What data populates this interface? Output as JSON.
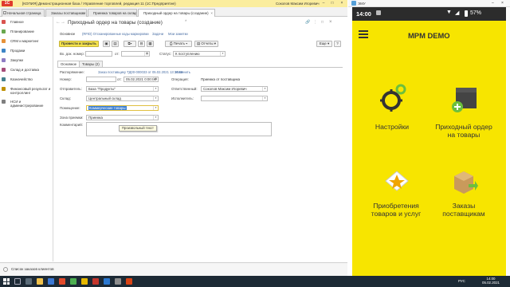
{
  "window": {
    "logo": "1С",
    "title": "[КОПИЯ] Демонстрационная база / Управление торговлей, редакция 11 (1С:Предприятие)",
    "user": "Соколов Максим Игоревич"
  },
  "tabs": [
    {
      "label": "Начальная страница"
    },
    {
      "label": "Заказы поставщикам"
    },
    {
      "label": "Приемка товаров на склад"
    },
    {
      "label": "Приходный ордер на товары (создание)"
    }
  ],
  "sidebar": [
    {
      "label": "Главное",
      "color": "#d9534f"
    },
    {
      "label": "Планирование",
      "color": "#6aa84f"
    },
    {
      "label": "CRM и маркетинг",
      "color": "#e69138"
    },
    {
      "label": "Продажи",
      "color": "#3d85c6"
    },
    {
      "label": "Закупки",
      "color": "#8e7cc3"
    },
    {
      "label": "Склад и доставка",
      "color": "#a64d79"
    },
    {
      "label": "Казначейство",
      "color": "#45818e"
    },
    {
      "label": "Финансовый результат и контроллинг",
      "color": "#bf9000"
    },
    {
      "label": "НСИ и администрирование",
      "color": "#7f7f7f"
    }
  ],
  "form": {
    "title": "Приходный ордер на товары (создание)",
    "star": "*",
    "links": [
      "Основное",
      "(RFID) Отсканированные коды маркировки",
      "Задачи",
      "Мои заметки"
    ],
    "toolbar": {
      "post_close": "Провести и закрыть",
      "print": "Печать",
      "reports": "Отчеты",
      "more": "Еще",
      "help": "?"
    },
    "header": {
      "inc_num_label": "Вх. док. номер:",
      "date_label": "от:",
      "status_label": "Статус:",
      "status_value": "К поступлению"
    },
    "subtabs": [
      "Основное",
      "Товары (2)"
    ],
    "fields": {
      "order_label": "Распоряжение:",
      "order_value": "Заказ поставщику ТД00-000033 от 05.02.2021 13:38:09",
      "change_link": "Изменить",
      "number_label": "Номер:",
      "number_date_prefix": "от:",
      "number_date": "05.02.2021  0:00:00",
      "sender_label": "Отправитель:",
      "sender_value": "База \"Продукты\"",
      "warehouse_label": "Склад:",
      "warehouse_value": "Центральный склад",
      "room_label": "Помещение:",
      "room_value": "Коммерческие товары",
      "zone_label": "Зона приемки:",
      "zone_value": "Приемка",
      "comment_label": "Комментарий:",
      "operation_label": "Операция:",
      "operation_value": "Приемка от поставщика",
      "responsible_label": "Ответственный:",
      "responsible_value": "Соколов Максим Игоревич",
      "executor_label": "Исполнитель:"
    },
    "tooltip": "Произвольный текст"
  },
  "statusbar": {
    "text": "Список заказов клиентов"
  },
  "emulator": {
    "title": "ЭМУ"
  },
  "phone": {
    "time": "14:00",
    "battery": "57%",
    "app_title": "MPM DEMO",
    "tiles": [
      {
        "label": "Настройки",
        "icon": "gears-icon"
      },
      {
        "label": "Приходный ордер на товары",
        "icon": "box-in-icon"
      },
      {
        "label": "Приобретения товаров и услуг",
        "icon": "star-envelope-icon"
      },
      {
        "label": "Заказы поставщикам",
        "icon": "box-arrow-icon"
      }
    ]
  },
  "taskbar": {
    "time": "14:00",
    "date": "05.02.2021",
    "lang": "РУС"
  }
}
